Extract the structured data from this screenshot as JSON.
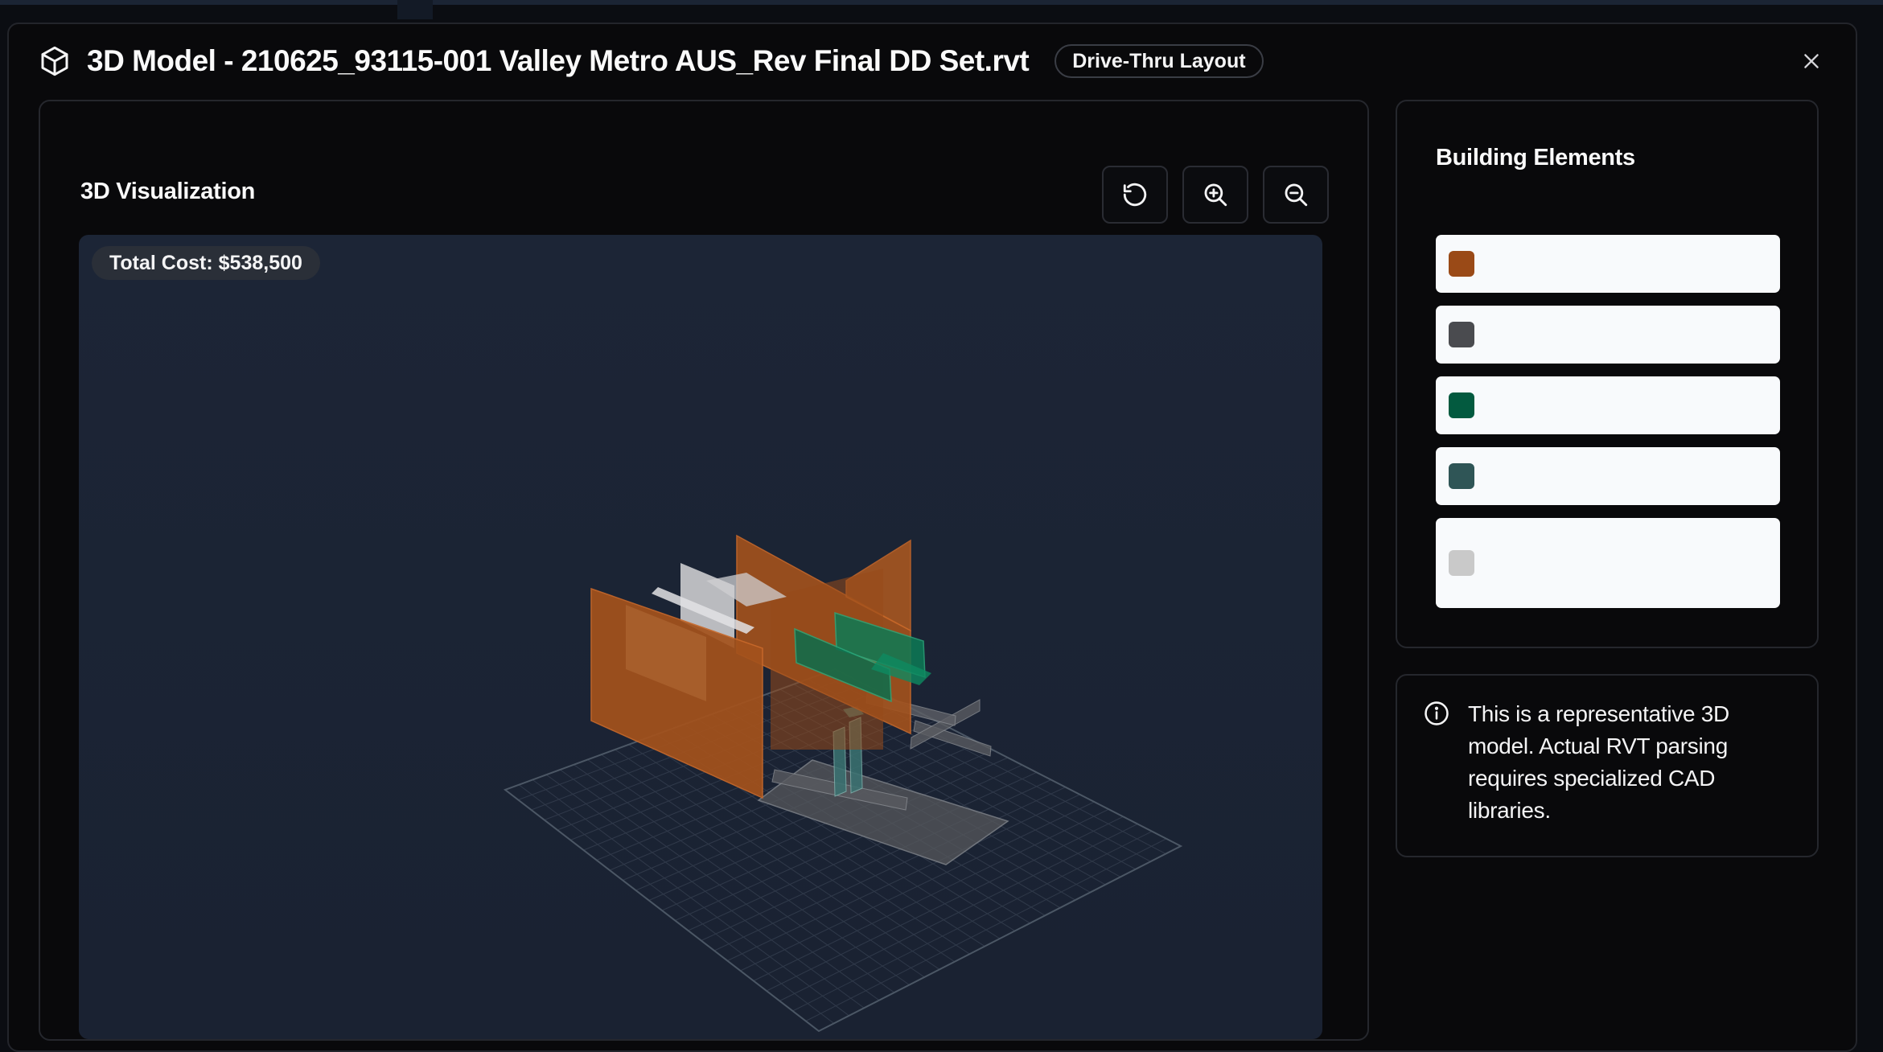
{
  "header": {
    "title": "3D Model - 210625_93115-001 Valley Metro AUS_Rev Final DD Set.rvt",
    "badge": "Drive-Thru Layout"
  },
  "visualization": {
    "title": "3D Visualization",
    "total_cost": "Total Cost: $538,500",
    "tools": [
      {
        "name": "reset-view",
        "icon": "rotate-ccw-icon"
      },
      {
        "name": "zoom-in",
        "icon": "zoom-in-icon"
      },
      {
        "name": "zoom-out",
        "icon": "zoom-out-icon"
      }
    ]
  },
  "building_elements": {
    "title": "Building Elements",
    "items": [
      {
        "label": "",
        "color": "#9a4a17"
      },
      {
        "label": "",
        "color": "#4a4b4f"
      },
      {
        "label": "",
        "color": "#035a3f"
      },
      {
        "label": "",
        "color": "#2f5556"
      },
      {
        "label": "",
        "color": "#c9c9c9"
      }
    ]
  },
  "info": {
    "text": "This is a representative 3D model. Actual RVT parsing requires specialized CAD libraries."
  }
}
